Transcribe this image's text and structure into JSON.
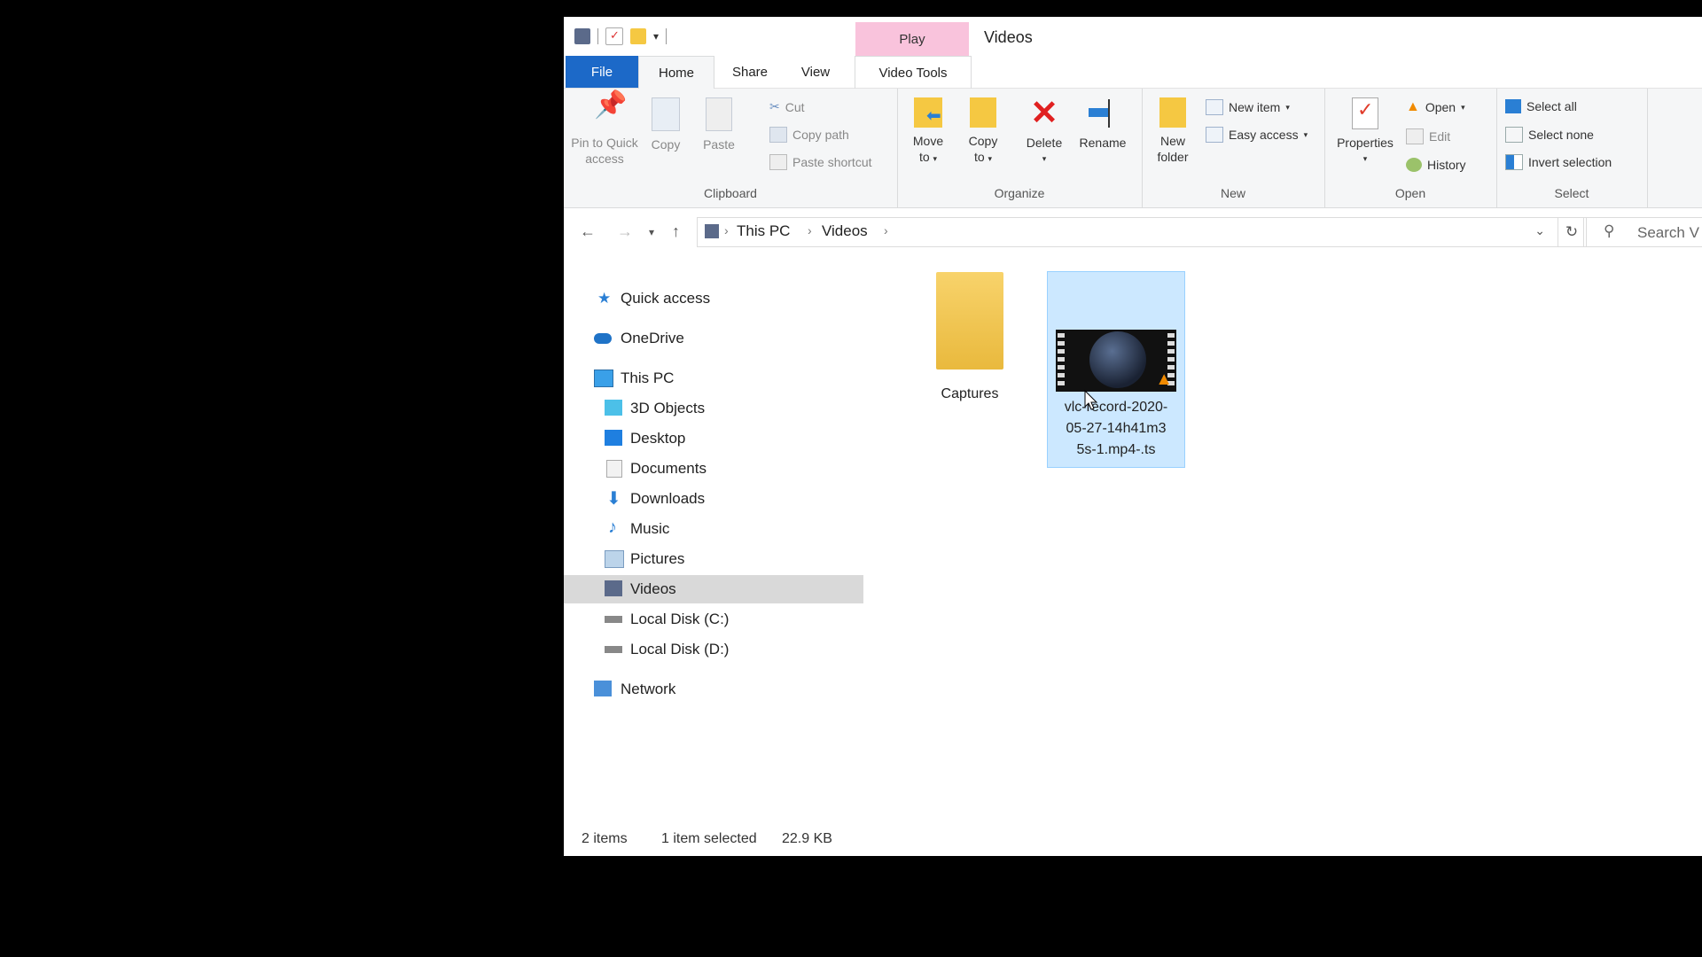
{
  "window": {
    "title": "Videos",
    "context_tab": "Play"
  },
  "tabs": {
    "file": "File",
    "home": "Home",
    "share": "Share",
    "view": "View",
    "video_tools": "Video Tools"
  },
  "ribbon": {
    "clipboard": {
      "label": "Clipboard",
      "pin_line1": "Pin to Quick",
      "pin_line2": "access",
      "copy": "Copy",
      "paste": "Paste",
      "cut": "Cut",
      "copy_path": "Copy path",
      "paste_shortcut": "Paste shortcut"
    },
    "organize": {
      "label": "Organize",
      "move_line1": "Move",
      "move_line2": "to",
      "copy_line1": "Copy",
      "copy_line2": "to",
      "delete": "Delete",
      "rename": "Rename"
    },
    "new": {
      "label": "New",
      "folder_line1": "New",
      "folder_line2": "folder",
      "new_item": "New item",
      "easy_access": "Easy access"
    },
    "open": {
      "label": "Open",
      "properties": "Properties",
      "open": "Open",
      "edit": "Edit",
      "history": "History"
    },
    "select": {
      "label": "Select",
      "select_all": "Select all",
      "select_none": "Select none",
      "invert": "Invert selection"
    }
  },
  "address": {
    "crumbs": [
      "This PC",
      "Videos"
    ],
    "search_placeholder": "Search V"
  },
  "nav": {
    "quick_access": "Quick access",
    "onedrive": "OneDrive",
    "this_pc": "This PC",
    "children": [
      "3D Objects",
      "Desktop",
      "Documents",
      "Downloads",
      "Music",
      "Pictures",
      "Videos",
      "Local Disk (C:)",
      "Local Disk (D:)"
    ],
    "network": "Network",
    "selected": "Videos"
  },
  "files": [
    {
      "name": "Captures",
      "type": "folder"
    },
    {
      "name_line1": "vlc-record-2020-",
      "name_line2": "05-27-14h41m3",
      "name_line3": "5s-1.mp4-.ts",
      "type": "video",
      "selected": true
    }
  ],
  "status": {
    "count": "2 items",
    "selection": "1 item selected",
    "size": "22.9 KB"
  },
  "colors": {
    "file_tab": "#1c69c8",
    "play_tab": "#f9c3dc",
    "selection": "#cce8ff",
    "nav_selected": "#d9d9d9"
  }
}
